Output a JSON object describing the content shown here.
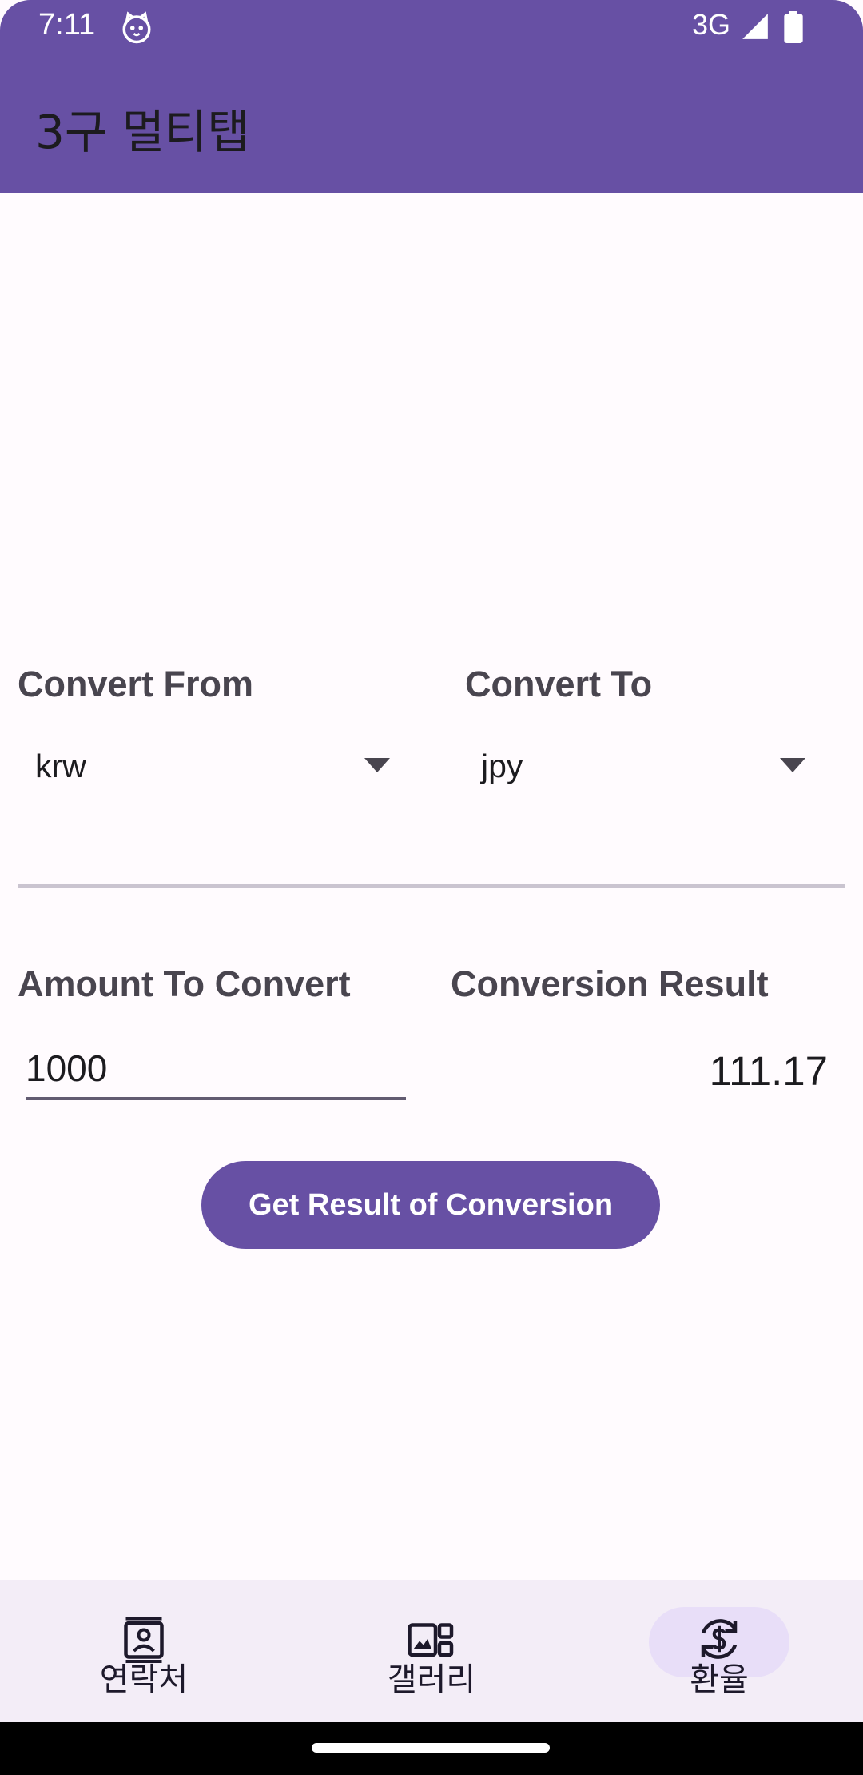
{
  "status_bar": {
    "time": "7:11",
    "network": "3G",
    "app_icon": "cat-face-icon",
    "signal_icon": "cellular-signal-icon",
    "battery_icon": "battery-icon"
  },
  "app_bar": {
    "title": "3구 멀티탭"
  },
  "converter": {
    "from_label": "Convert From",
    "from_value": "krw",
    "to_label": "Convert To",
    "to_value": "jpy",
    "amount_label": "Amount To Convert",
    "amount_value": "1000",
    "result_label": "Conversion Result",
    "result_value": "111.17",
    "button_label": "Get Result of Conversion"
  },
  "bottom_nav": {
    "items": [
      {
        "label": "연락처",
        "icon": "contact-card-icon",
        "selected": false
      },
      {
        "label": "갤러리",
        "icon": "gallery-icon",
        "selected": false
      },
      {
        "label": "환율",
        "icon": "currency-exchange-icon",
        "selected": true
      }
    ]
  },
  "colors": {
    "primary": "#6750a4",
    "on_primary": "#ffffff",
    "surface": "#fffbfe",
    "nav_background": "#f3edf7",
    "nav_indicator": "#e8def8"
  }
}
